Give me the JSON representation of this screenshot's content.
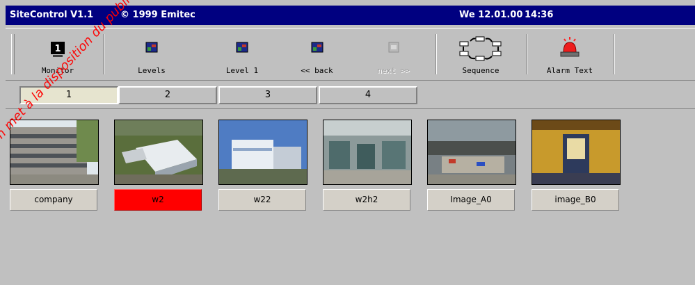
{
  "titlebar": {
    "app": "SiteControl V1.1",
    "copyright": "© 1999 Emitec",
    "date": "We 12.01.00",
    "time": "14:36"
  },
  "toolbar": {
    "buttons": [
      {
        "label": "Monitor",
        "icon": "monitor-icon"
      },
      {
        "label": "Levels",
        "icon": "levels-icon"
      },
      {
        "label": "Level 1",
        "icon": "level-icon"
      },
      {
        "label": "<< back",
        "icon": "back-icon"
      },
      {
        "label": "next >>",
        "icon": "next-icon",
        "disabled": true
      },
      {
        "label": "Sequence",
        "icon": "sequence-icon"
      },
      {
        "label": "Alarm Text",
        "icon": "alarm-icon"
      }
    ]
  },
  "tabs": [
    "1",
    "2",
    "3",
    "4"
  ],
  "active_tab": "1",
  "images": [
    {
      "label": "company",
      "selected": false
    },
    {
      "label": "w2",
      "selected": true
    },
    {
      "label": "w22",
      "selected": false
    },
    {
      "label": "w2h2",
      "selected": false
    },
    {
      "label": "Image_A0",
      "selected": false
    },
    {
      "label": "image_B0",
      "selected": false
    }
  ],
  "watermark": "...com met à la disposition du public",
  "colors": {
    "titlebar": "#000080",
    "selected_tile": "#ff0000",
    "active_tab": "#e6e4cf"
  }
}
